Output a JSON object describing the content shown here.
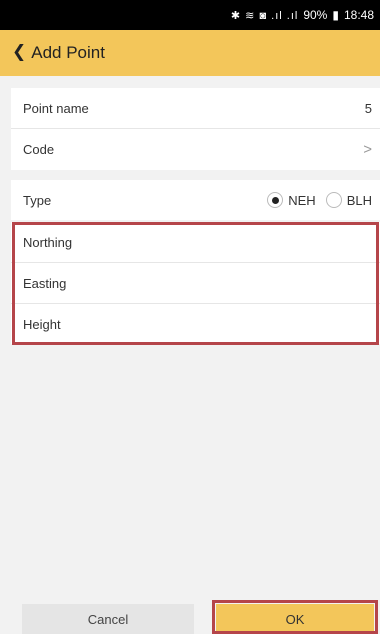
{
  "status_bar": {
    "icons": "✱ ≋ ◙ .ıl .ıl",
    "battery_text": "90%",
    "time": "18:48"
  },
  "app_bar": {
    "back_icon": "chevron-left-icon",
    "title": "Add Point"
  },
  "form": {
    "point_name": {
      "label": "Point name",
      "value": "5"
    },
    "code": {
      "label": "Code",
      "chevron": ">"
    },
    "type": {
      "label": "Type",
      "options": [
        {
          "label": "NEH",
          "selected": true
        },
        {
          "label": "BLH",
          "selected": false
        }
      ]
    },
    "coordinates": [
      {
        "label": "Northing"
      },
      {
        "label": "Easting"
      },
      {
        "label": "Height"
      }
    ]
  },
  "actions": {
    "cancel_label": "Cancel",
    "ok_label": "OK"
  },
  "colors": {
    "accent": "#f3c65a",
    "highlight": "#b5454a",
    "status_bar": "#000000",
    "background": "#f2f2f2"
  }
}
